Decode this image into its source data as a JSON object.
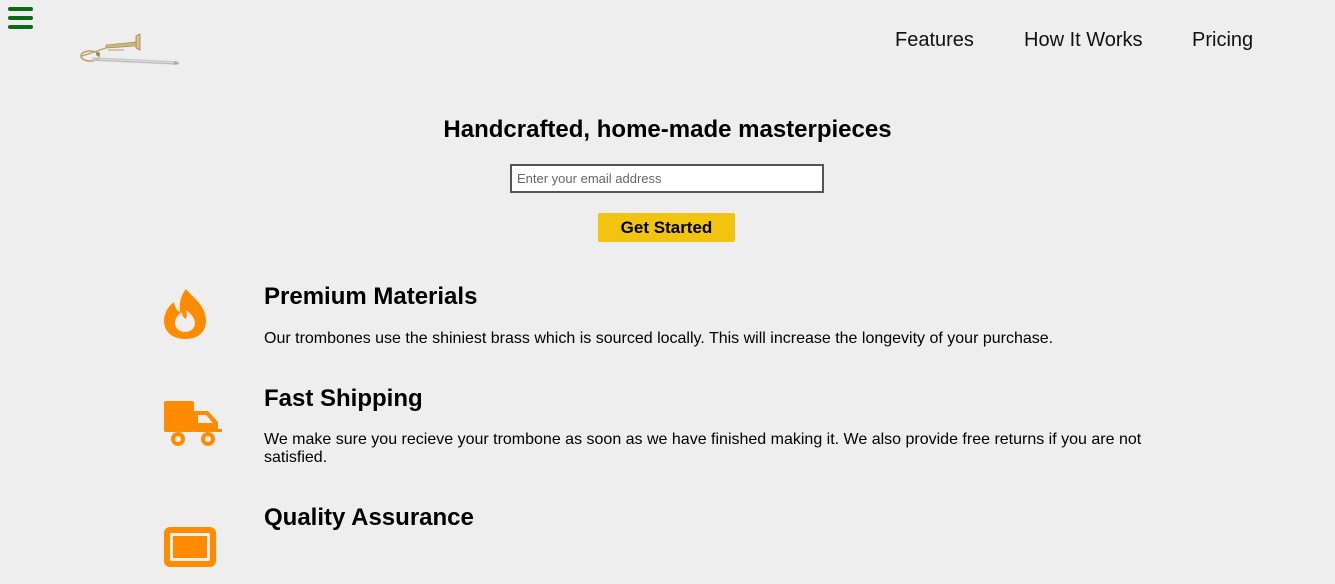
{
  "nav": {
    "links": [
      {
        "label": "Features"
      },
      {
        "label": "How It Works"
      },
      {
        "label": "Pricing"
      }
    ]
  },
  "hero": {
    "title": "Handcrafted, home-made masterpieces",
    "email_placeholder": "Enter your email address",
    "cta_label": "Get Started"
  },
  "features": [
    {
      "icon": "fire-icon",
      "title": "Premium Materials",
      "text": "Our trombones use the shiniest brass which is sourced locally. This will increase the longevity of your purchase."
    },
    {
      "icon": "truck-icon",
      "title": "Fast Shipping",
      "text": "We make sure you recieve your trombone as soon as we have finished making it. We also provide free returns if you are not satisfied."
    },
    {
      "icon": "battery-icon",
      "title": "Quality Assurance",
      "text": ""
    }
  ],
  "colors": {
    "background": "#eeeeee",
    "hamburger": "#0a6b12",
    "icon_orange": "#ff8c00",
    "cta_yellow": "#f1c40f"
  }
}
